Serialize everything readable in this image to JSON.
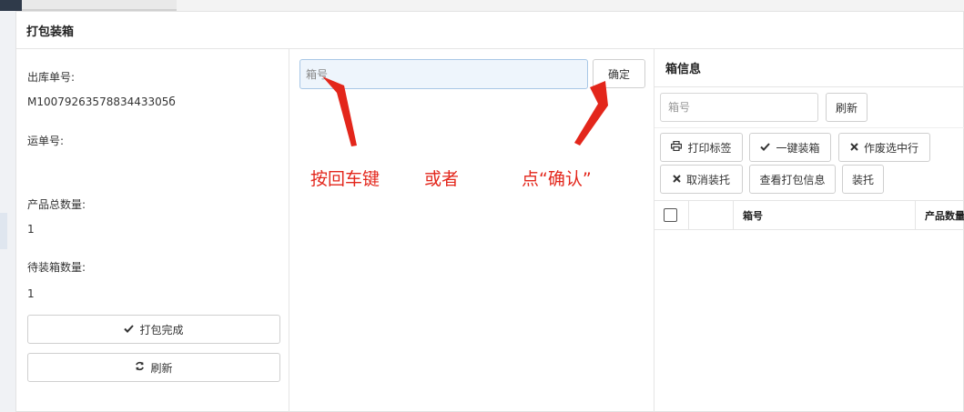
{
  "panel": {
    "title": "打包装箱"
  },
  "left": {
    "order_label": "出库单号:",
    "order_value": "M1007926357883443305б",
    "waybill_label": "运单号:",
    "waybill_value": "",
    "total_label": "产品总数量:",
    "total_value": "1",
    "pending_label": "待装箱数量:",
    "pending_value": "1",
    "finish_button": "打包完成",
    "refresh_button": "刷新"
  },
  "middle": {
    "box_input_placeholder": "箱号",
    "confirm_button": "确定",
    "annotations": {
      "enter": "按回车键",
      "or": "或者",
      "click": "点“确认”"
    },
    "arrow_color": "#e3261b"
  },
  "right": {
    "title": "箱信息",
    "box_input_placeholder": "箱号",
    "refresh_button": "刷新",
    "print_button": "打印标签",
    "onekey_button": "一键装箱",
    "void_button": "作废选中行",
    "cancel_button": "取消装托",
    "view_button": "查看打包信息",
    "pallet_button": "装托",
    "columns": [
      "箱号",
      "产品数量"
    ]
  },
  "icons": {
    "check": "check-icon",
    "refresh": "refresh-icon",
    "print": "print-icon",
    "close": "close-icon"
  }
}
